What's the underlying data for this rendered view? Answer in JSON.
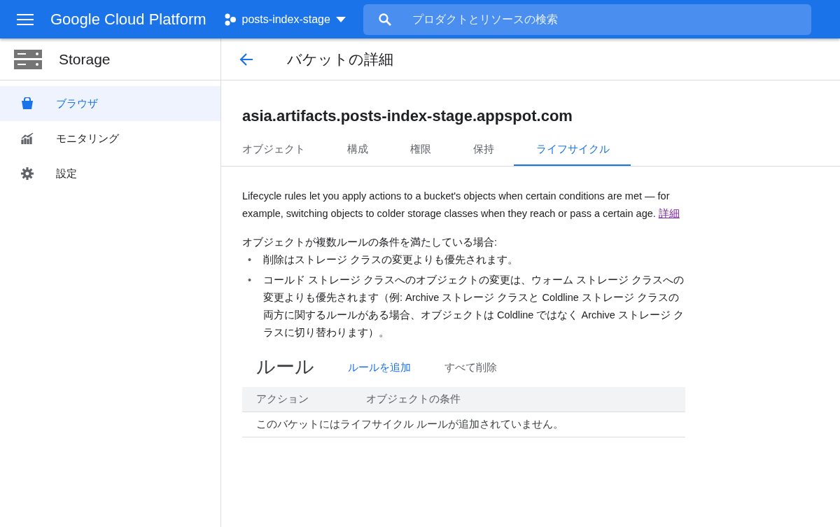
{
  "header": {
    "product": "Google Cloud Platform",
    "project": "posts-index-stage",
    "search": {
      "placeholder": "プロダクトとリソースの検索"
    }
  },
  "sidebar": {
    "title": "Storage",
    "items": [
      {
        "label": "ブラウザ",
        "kind": "bucket",
        "selected": true
      },
      {
        "label": "モニタリング",
        "kind": "chart",
        "selected": false
      },
      {
        "label": "設定",
        "kind": "gear",
        "selected": false
      }
    ]
  },
  "page": {
    "title": "バケットの詳細",
    "bucket": "asia.artifacts.posts-index-stage.appspot.com",
    "tabs": [
      {
        "label": "オブジェクト",
        "selected": false
      },
      {
        "label": "構成",
        "selected": false
      },
      {
        "label": "権限",
        "selected": false
      },
      {
        "label": "保持",
        "selected": false
      },
      {
        "label": "ライフサイクル",
        "selected": true
      }
    ],
    "intro": {
      "text": "Lifecycle rules let you apply actions to a bucket's objects when certain conditions are met — for example, switching objects to colder storage classes when they reach or pass a certain age.",
      "link": "詳細"
    },
    "precedence_lead": "オブジェクトが複数ルールの条件を満たしている場合:",
    "precedence_items": [
      {
        "bullet": "•",
        "text": "削除はストレージ クラスの変更よりも優先されます。"
      },
      {
        "bullet": "•",
        "text": "コールド ストレージ クラスへのオブジェクトの変更は、ウォーム ストレージ クラスへの変更よりも優先されます（例: Archive ストレージ クラスと Coldline ストレージ クラスの両方に関するルールがある場合、オブジェクトは Coldline ではなく Archive ストレージ クラスに切り替わります）。"
      }
    ],
    "rules": {
      "title": "ルール",
      "actions": [
        {
          "label": "ルールを追加",
          "disabled": false
        },
        {
          "label": "すべて削除",
          "disabled": true
        }
      ],
      "columns": [
        "アクション",
        "オブジェクトの条件"
      ],
      "empty_message": "このバケットにはライフサイクル ルールが追加されていません。"
    }
  }
}
